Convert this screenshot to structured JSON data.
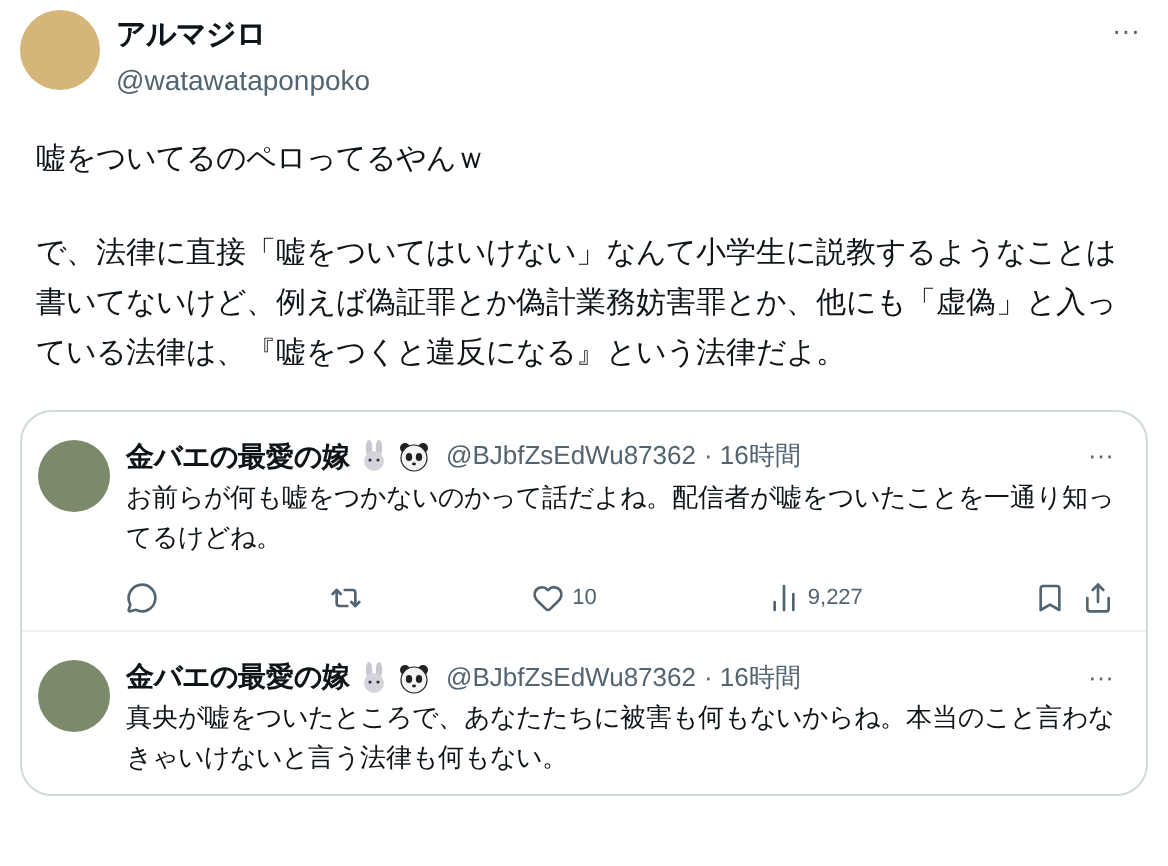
{
  "post": {
    "author": "アルマジロ",
    "handle": "@watawataponpoko",
    "more": "···",
    "text": [
      "嘘をついてるのペロってるやんｗ",
      "で、法律に直接「嘘をついてはいけない」なんて小学生に説教するようなことは書いてないけど、例えば偽証罪とか偽計業務妨害罪とか、他にも「虚偽」と入っている法律は、『嘘をつくと違反になる』という法律だよ。"
    ]
  },
  "replies": [
    {
      "author": "金バエの最愛の嫁",
      "handle": "@BJbfZsEdWu87362",
      "time": "· 16時間",
      "more": "···",
      "text": "お前らが何も嘘をつかないのかって話だよね。配信者が嘘をついたことを一通り知ってるけどね。",
      "likes": "10",
      "views": "9,227"
    },
    {
      "author": "金バエの最愛の嫁",
      "handle": "@BJbfZsEdWu87362",
      "time": "· 16時間",
      "more": "···",
      "text": "真央が嘘をついたところで、あなたたちに被害も何もないからね。本当のこと言わなきゃいけないと言う法律も何もない。"
    }
  ]
}
